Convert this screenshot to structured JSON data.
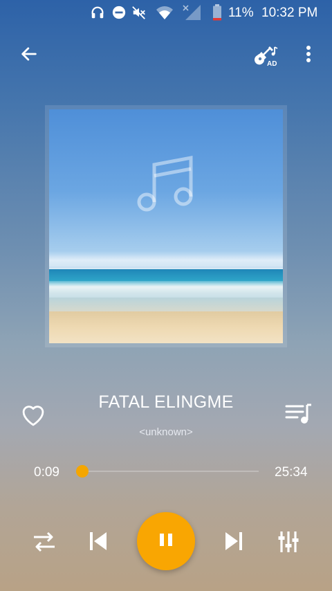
{
  "status_bar": {
    "icons": [
      "headphones-icon",
      "do-not-disturb-icon",
      "mute-icon",
      "wifi-icon",
      "no-signal-icon",
      "battery-low-icon"
    ],
    "battery_percent": "11%",
    "time": "10:32 PM"
  },
  "top_bar": {
    "back_icon": "arrow-back-icon",
    "ad_icon": "guitar-ad-icon",
    "ad_label": "AD",
    "more_icon": "more-vertical-icon"
  },
  "album_art": {
    "overlay_icon": "music-note-icon",
    "scene": "beach and sea under blue sky"
  },
  "song": {
    "title": "FATAL ELINGME",
    "artist": "<unknown>"
  },
  "progress": {
    "elapsed": "0:09",
    "total": "25:34",
    "fraction": 0.006,
    "accent_color": "#f5a600"
  },
  "controls": {
    "favorite_icon": "heart-outline-icon",
    "queue_icon": "playlist-music-icon",
    "repeat_icon": "repeat-icon",
    "previous_icon": "skip-previous-icon",
    "play_pause_icon": "pause-icon",
    "next_icon": "skip-next-icon",
    "equalizer_icon": "equalizer-icon",
    "play_button_color": "#f9a602"
  }
}
